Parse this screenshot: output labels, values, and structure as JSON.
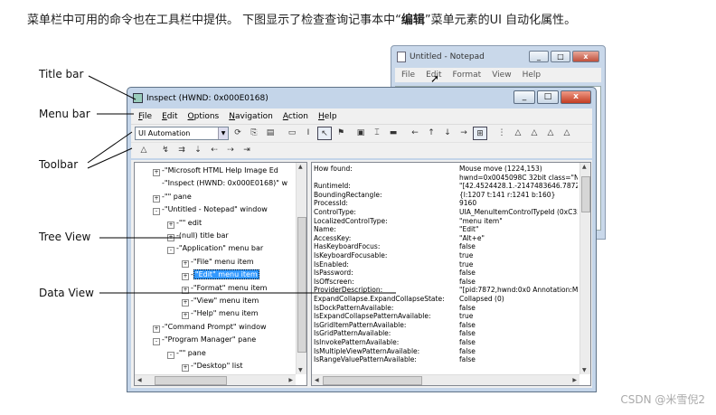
{
  "intro": {
    "before": "菜单栏中可用的命令也在工具栏中提供。 下图显示了检查查询记事本中“",
    "bold": "编辑",
    "after": "”菜单元素的UI 自动化属性。"
  },
  "notepad": {
    "title": "Untitled - Notepad",
    "menu": [
      "File",
      "Edit",
      "Format",
      "View",
      "Help"
    ]
  },
  "inspect": {
    "title": "Inspect  (HWND: 0x000E0168)",
    "menu": [
      "File",
      "Edit",
      "Options",
      "Navigation",
      "Action",
      "Help"
    ],
    "combo": "UI Automation"
  },
  "callouts": {
    "title_bar": "Title bar",
    "menu_bar": "Menu bar",
    "toolbar": "Toolbar",
    "tree_view": "Tree View",
    "data_view": "Data View"
  },
  "tree": [
    {
      "indent": 0,
      "exp": "+",
      "text": "\"Microsoft HTML Help Image Ed"
    },
    {
      "indent": 0,
      "exp": "",
      "text": "\"Inspect  (HWND: 0x000E0168)\" w"
    },
    {
      "indent": 0,
      "exp": "+",
      "text": "\"\" pane"
    },
    {
      "indent": 0,
      "exp": "-",
      "text": "\"Untitled - Notepad\" window"
    },
    {
      "indent": 1,
      "exp": "+",
      "text": "\"\" edit"
    },
    {
      "indent": 1,
      "exp": "+",
      "text": "(null) title bar"
    },
    {
      "indent": 1,
      "exp": "-",
      "text": "\"Application\" menu bar"
    },
    {
      "indent": 2,
      "exp": "+",
      "text": "\"File\" menu item"
    },
    {
      "indent": 2,
      "exp": "+",
      "text": "\"Edit\" menu item",
      "selected": true
    },
    {
      "indent": 2,
      "exp": "+",
      "text": "\"Format\" menu item"
    },
    {
      "indent": 2,
      "exp": "+",
      "text": "\"View\" menu item"
    },
    {
      "indent": 2,
      "exp": "+",
      "text": "\"Help\" menu item"
    },
    {
      "indent": 0,
      "exp": "+",
      "text": "\"Command Prompt\" window"
    },
    {
      "indent": 0,
      "exp": "-",
      "text": "\"Program Manager\" pane"
    },
    {
      "indent": 1,
      "exp": "-",
      "text": "\"\" pane"
    },
    {
      "indent": 2,
      "exp": "+",
      "text": "\"Desktop\" list"
    }
  ],
  "properties": [
    {
      "k": "How found:",
      "v": "Mouse move (1224,153)"
    },
    {
      "k": "",
      "v": "hwnd=0x0045098C 32bit class=\"No"
    },
    {
      "k": "RuntimeId:",
      "v": "\"[42.4524428.1.-2147483646.7872."
    },
    {
      "k": "BoundingRectangle:",
      "v": "{l:1207 t:141 r:1241 b:160}"
    },
    {
      "k": "ProcessId:",
      "v": "9160"
    },
    {
      "k": "ControlType:",
      "v": "UIA_MenuItemControlTypeId (0xC35"
    },
    {
      "k": "LocalizedControlType:",
      "v": "\"menu item\""
    },
    {
      "k": "Name:",
      "v": "\"Edit\""
    },
    {
      "k": "AccessKey:",
      "v": "\"Alt+e\""
    },
    {
      "k": "HasKeyboardFocus:",
      "v": "false"
    },
    {
      "k": "IsKeyboardFocusable:",
      "v": "true"
    },
    {
      "k": "IsEnabled:",
      "v": "true"
    },
    {
      "k": "IsPassword:",
      "v": "false"
    },
    {
      "k": "IsOffscreen:",
      "v": "false"
    },
    {
      "k": "ProviderDescription:",
      "v": "\"[pid:7872,hwnd:0x0 Annotation:Mic"
    },
    {
      "k": "ExpandCollapse.ExpandCollapseState:",
      "v": "Collapsed (0)"
    },
    {
      "k": "IsDockPatternAvailable:",
      "v": "false"
    },
    {
      "k": "IsExpandCollapsePatternAvailable:",
      "v": "true"
    },
    {
      "k": "IsGridItemPatternAvailable:",
      "v": "false"
    },
    {
      "k": "IsGridPatternAvailable:",
      "v": "false"
    },
    {
      "k": "IsInvokePatternAvailable:",
      "v": "false"
    },
    {
      "k": "IsMultipleViewPatternAvailable:",
      "v": "false"
    },
    {
      "k": "IsRangeValuePatternAvailable:",
      "v": "false"
    }
  ],
  "watermark": "CSDN @米雪倪2"
}
